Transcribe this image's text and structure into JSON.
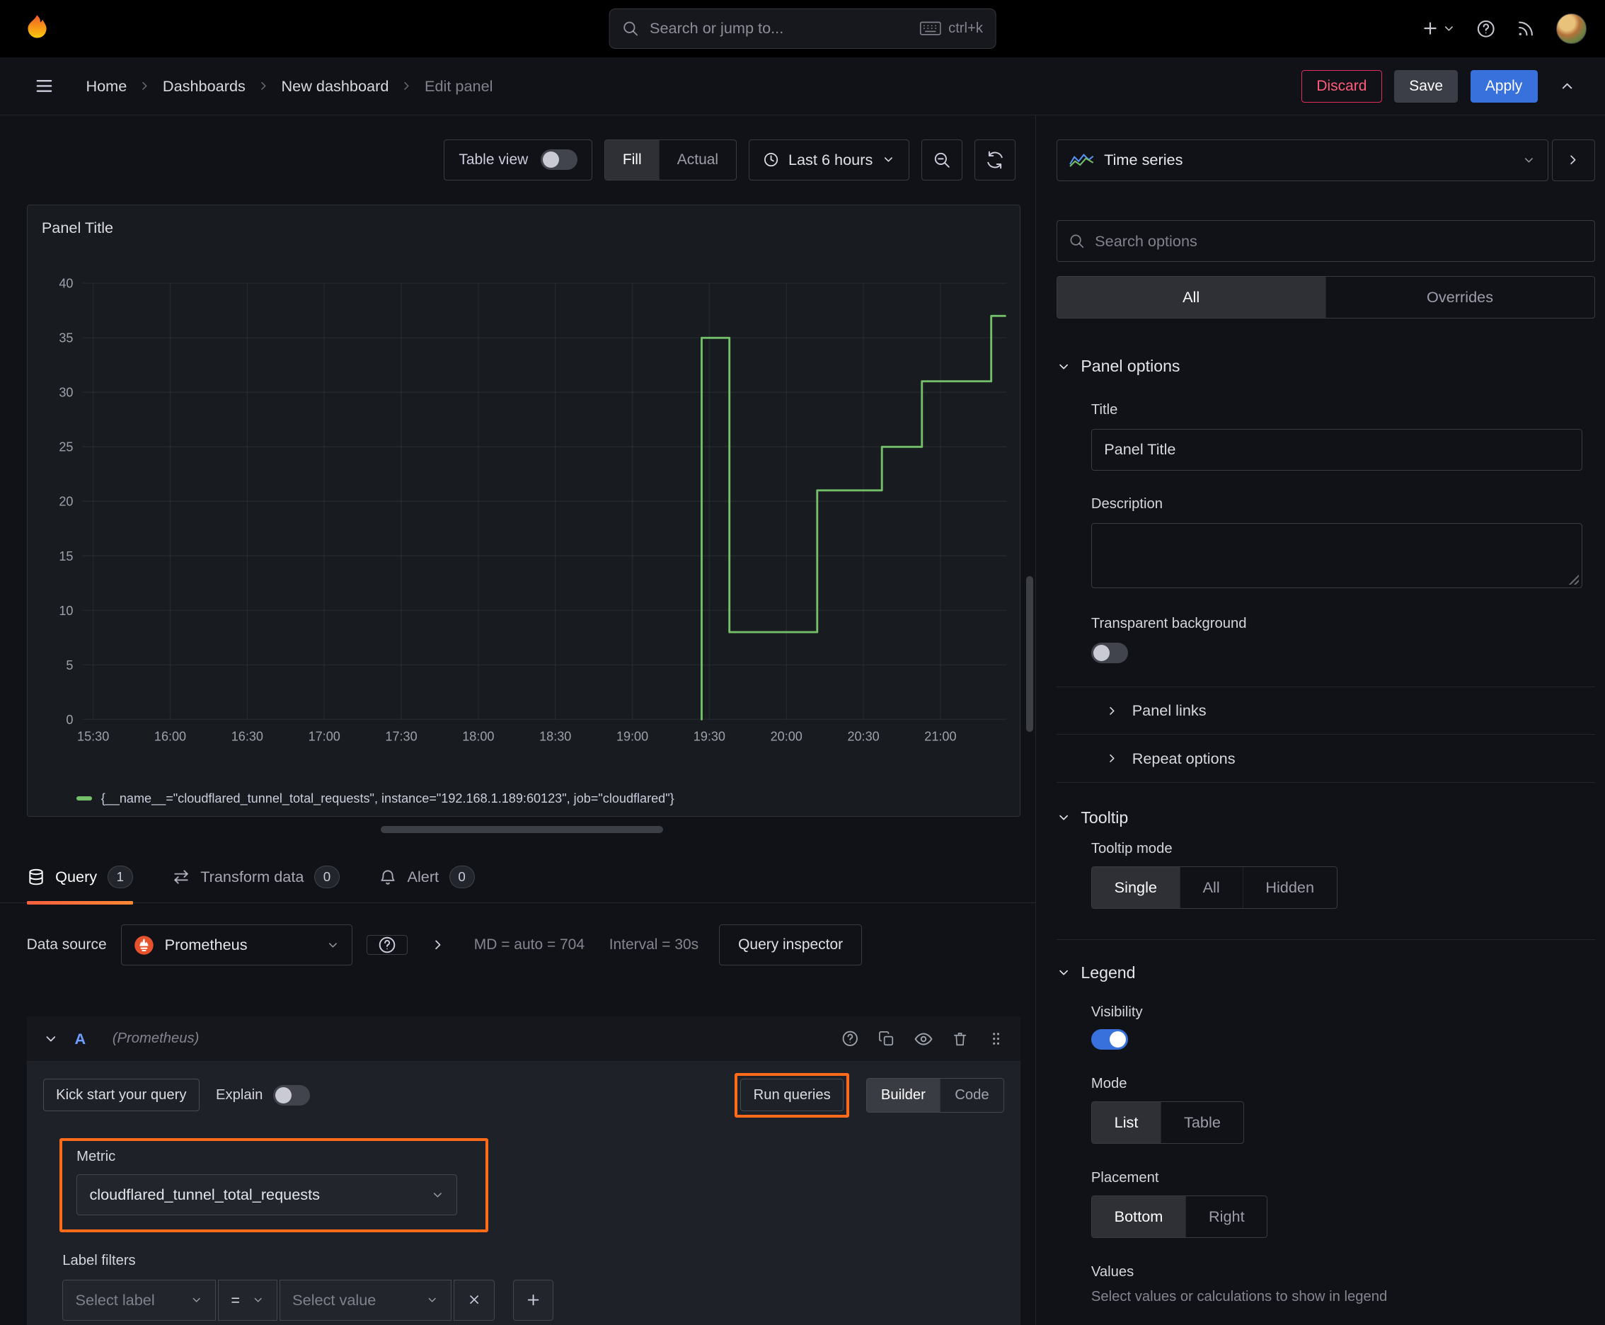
{
  "colors": {
    "series_green": "#73bf69",
    "primary_blue": "#3871dc",
    "highlight_orange": "#ff6b18",
    "destructive_red": "#ff5c7c",
    "tab_underline_gradient": [
      "#f55f3e",
      "#ff8833"
    ]
  },
  "topbar": {
    "search_placeholder": "Search or jump to...",
    "shortcut": "ctrl+k"
  },
  "breadcrumb": {
    "items": [
      "Home",
      "Dashboards",
      "New dashboard",
      "Edit panel"
    ]
  },
  "actions": {
    "discard": "Discard",
    "save": "Save",
    "apply": "Apply"
  },
  "toolbar": {
    "table_view_label": "Table view",
    "fill_label": "Fill",
    "actual_label": "Actual",
    "time_range_label": "Last 6 hours"
  },
  "panel": {
    "title": "Panel Title",
    "legend_text": "{__name__=\"cloudflared_tunnel_total_requests\", instance=\"192.168.1.189:60123\", job=\"cloudflared\"}"
  },
  "chart_data": {
    "type": "line",
    "title": "Panel Title",
    "xlabel": "",
    "ylabel": "",
    "x_ticks": [
      "15:30",
      "16:00",
      "16:30",
      "17:00",
      "17:30",
      "18:00",
      "18:30",
      "19:00",
      "19:30",
      "20:00",
      "20:30",
      "21:00"
    ],
    "x_tick_hours": [
      15.5,
      16,
      16.5,
      17,
      17.5,
      18,
      18.5,
      19,
      19.5,
      20,
      20.5,
      21
    ],
    "x_range": [
      15.43,
      21.43
    ],
    "y_ticks": [
      0,
      5,
      10,
      15,
      20,
      25,
      30,
      35,
      40
    ],
    "y_range": [
      0,
      40
    ],
    "grid": true,
    "legend_position": "bottom",
    "series": [
      {
        "name": "{__name__=\"cloudflared_tunnel_total_requests\", instance=\"192.168.1.189:60123\", job=\"cloudflared\"}",
        "color": "#73bf69",
        "points": [
          [
            19.45,
            0
          ],
          [
            19.45,
            35
          ],
          [
            19.63,
            35
          ],
          [
            19.63,
            8
          ],
          [
            20.2,
            8
          ],
          [
            20.2,
            21
          ],
          [
            20.62,
            21
          ],
          [
            20.62,
            25
          ],
          [
            20.88,
            25
          ],
          [
            20.88,
            31
          ],
          [
            21.33,
            31
          ],
          [
            21.33,
            37
          ],
          [
            21.42,
            37
          ]
        ]
      }
    ]
  },
  "tabs": {
    "query": {
      "label": "Query",
      "count": "1"
    },
    "transform": {
      "label": "Transform data",
      "count": "0"
    },
    "alert": {
      "label": "Alert",
      "count": "0"
    }
  },
  "query": {
    "data_source_label": "Data source",
    "data_source_name": "Prometheus",
    "max_data_points": "MD = auto = 704",
    "interval": "Interval = 30s",
    "inspector_label": "Query inspector",
    "ref_id": "A",
    "ds_hint": "(Prometheus)",
    "kick_start_label": "Kick start your query",
    "explain_label": "Explain",
    "run_queries_label": "Run queries",
    "builder_label": "Builder",
    "code_label": "Code",
    "metric_label": "Metric",
    "metric_value": "cloudflared_tunnel_total_requests",
    "label_filters_label": "Label filters",
    "select_label_placeholder": "Select label",
    "operator": "=",
    "select_value_placeholder": "Select value"
  },
  "sidebar": {
    "visualization": "Time series",
    "search_placeholder": "Search options",
    "tab_all": "All",
    "tab_overrides": "Overrides",
    "panel_options": {
      "header": "Panel options",
      "title_label": "Title",
      "title_value": "Panel Title",
      "description_label": "Description",
      "transparent_label": "Transparent background",
      "panel_links": "Panel links",
      "repeat_options": "Repeat options"
    },
    "tooltip": {
      "header": "Tooltip",
      "mode_label": "Tooltip mode",
      "options": [
        "Single",
        "All",
        "Hidden"
      ],
      "selected": "Single"
    },
    "legend": {
      "header": "Legend",
      "visibility_label": "Visibility",
      "mode_label": "Mode",
      "modes": [
        "List",
        "Table"
      ],
      "selected_mode": "List",
      "placement_label": "Placement",
      "placements": [
        "Bottom",
        "Right"
      ],
      "selected_placement": "Bottom",
      "values_label": "Values",
      "values_hint": "Select values or calculations to show in legend"
    }
  }
}
